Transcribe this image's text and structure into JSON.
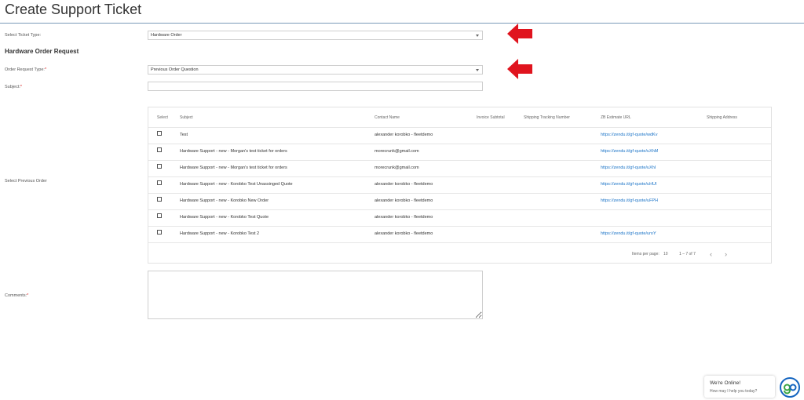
{
  "header": {
    "title": "Create Support Ticket"
  },
  "ticket_type": {
    "label": "Select Ticket Type:",
    "value": "Hardware Order"
  },
  "section": {
    "heading": "Hardware Order Request"
  },
  "order_request_type": {
    "label": "Order Request Type:",
    "required_mark": "*",
    "value": "Previous Order Question"
  },
  "subject": {
    "label": "Subject:",
    "required_mark": "*",
    "value": ""
  },
  "previous_order": {
    "label": "Select Previous Order"
  },
  "table": {
    "columns": [
      "Select",
      "Subject",
      "Contact Name",
      "Invoice Subtotal",
      "Shipping Tracking Number",
      "ZB Estimate URL",
      "Shipping Address"
    ],
    "rows": [
      {
        "subject": "Test",
        "contact": "alexander korobko - fleetdemo",
        "invoice": "",
        "tracking": "",
        "url": "https://zendu.it/gf-quote/wdKv",
        "address": ""
      },
      {
        "subject": "Hardware Support - new - Morgan's test ticket for orders",
        "contact": "morecrunk@gmail.com",
        "invoice": "",
        "tracking": "",
        "url": "https://zendu.it/gf-quote/uXhM",
        "address": ""
      },
      {
        "subject": "Hardware Support - new - Morgan's test ticket for orders",
        "contact": "morecrunk@gmail.com",
        "invoice": "",
        "tracking": "",
        "url": "https://zendu.it/gf-quote/uXhl",
        "address": ""
      },
      {
        "subject": "Hardware Support - new - Korobko Test Unassinged Quote",
        "contact": "alexander korobko - fleetdemo",
        "invoice": "",
        "tracking": "",
        "url": "https://zendu.it/gf-quote/uHUl",
        "address": ""
      },
      {
        "subject": "Hardware Support - new - Korobko New Order",
        "contact": "alexander korobko - fleetdemo",
        "invoice": "",
        "tracking": "",
        "url": "https://zendu.it/gf-quote/uFPH",
        "address": ""
      },
      {
        "subject": "Hardware Support - new - Korobko Test Quote",
        "contact": "alexander korobko - fleetdemo",
        "invoice": "",
        "tracking": "",
        "url": "",
        "address": ""
      },
      {
        "subject": "Hardware Support - new - Korobko Test 2",
        "contact": "alexander korobko - fleetdemo",
        "invoice": "",
        "tracking": "",
        "url": "https://zendu.it/gf-quote/uroY",
        "address": ""
      }
    ],
    "paginator": {
      "items_label": "Items per page:",
      "items_per_page": "10",
      "range": "1 – 7 of 7"
    }
  },
  "comments": {
    "label": "Comments:",
    "required_mark": "*",
    "value": ""
  },
  "chat": {
    "title": "We're Online!",
    "subtitle": "How may I help you today?"
  },
  "colors": {
    "accent_link": "#1a73c7",
    "arrow": "#e0141e",
    "required": "#e02020",
    "logo": "#1565c0"
  },
  "icons": {
    "arrow": "red-arrow-left-icon",
    "dropdown": "chevron-down-icon",
    "prev": "chevron-left-icon",
    "next": "chevron-right-icon",
    "chat": "go-logo-icon"
  }
}
